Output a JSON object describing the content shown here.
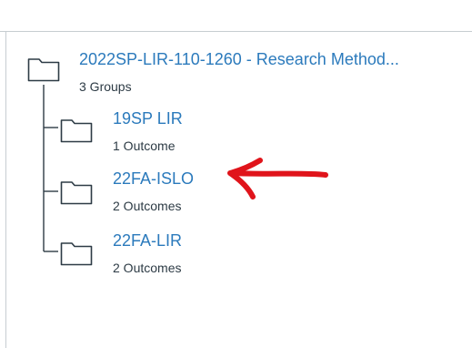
{
  "root": {
    "title": "2022SP-LIR-110-1260 - Research Method...",
    "subtitle": "3 Groups"
  },
  "groups": [
    {
      "title": "19SP LIR",
      "subtitle": "1 Outcome"
    },
    {
      "title": "22FA-ISLO",
      "subtitle": "2 Outcomes"
    },
    {
      "title": "22FA-LIR",
      "subtitle": "2 Outcomes"
    }
  ],
  "colors": {
    "link": "#2b7abc",
    "text": "#2d3b45",
    "icon": "#2d3b45",
    "border": "#c7cdd1",
    "annotation": "#e0141b"
  }
}
